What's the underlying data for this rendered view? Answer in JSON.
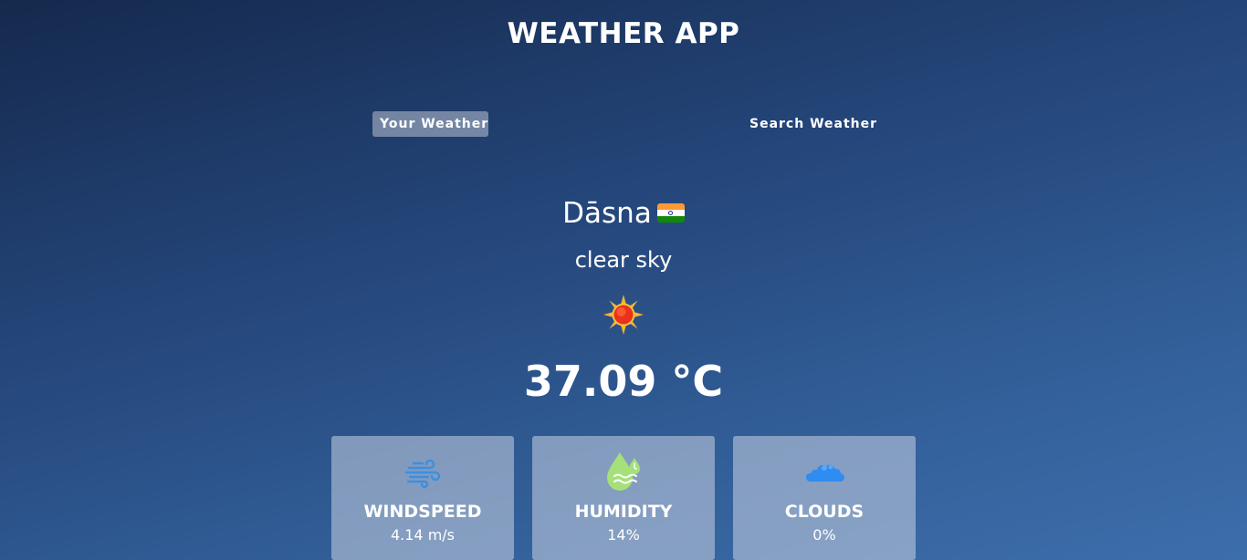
{
  "app": {
    "title": "WEATHER APP"
  },
  "tabs": [
    {
      "label": "Your Weather",
      "active": true
    },
    {
      "label": "Search Weather",
      "active": false
    }
  ],
  "weather": {
    "city": "Dāsna",
    "country_flag": "india-flag-icon",
    "description": "clear sky",
    "icon": "sun-icon",
    "temperature": "37.09 °C"
  },
  "stats": [
    {
      "label": "WINDSPEED",
      "value": "4.14 m/s",
      "icon": "wind-icon"
    },
    {
      "label": "HUMIDITY",
      "value": "14%",
      "icon": "humidity-icon"
    },
    {
      "label": "CLOUDS",
      "value": "0%",
      "icon": "clouds-icon"
    }
  ],
  "colors": {
    "background_top": "#15294d",
    "background_bottom": "#3d6eac",
    "active_tab": "#8a9bb8",
    "card": "#8ba0c2",
    "wind_icon": "#3b8fe0",
    "humidity_icon": "#a6e07a",
    "clouds_icon": "#2f8cf0"
  }
}
